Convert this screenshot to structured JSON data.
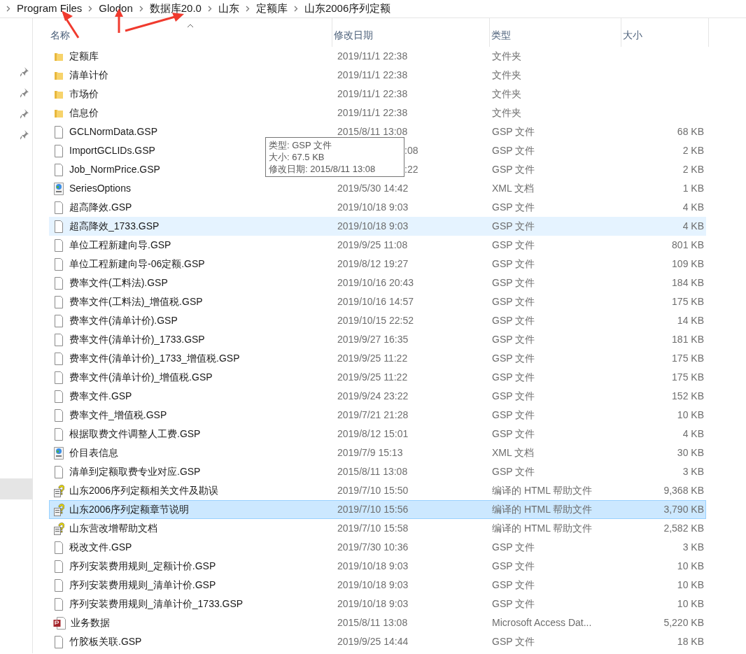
{
  "breadcrumb": [
    "Program Files",
    "Glodon",
    "数据库20.0",
    "山东",
    "定额库",
    "山东2006序列定额"
  ],
  "columns": [
    {
      "label": "名称",
      "sorted": true
    },
    {
      "label": "修改日期",
      "sorted": false
    },
    {
      "label": "类型",
      "sorted": false
    },
    {
      "label": "大小",
      "sorted": false
    }
  ],
  "rows": [
    {
      "kind": "folder",
      "name": "定额库",
      "date": "2019/11/1 22:38",
      "type": "文件夹",
      "size": "",
      "hovered": false,
      "selected": false,
      "date_covered": false
    },
    {
      "kind": "folder",
      "name": "清单计价",
      "date": "2019/11/1 22:38",
      "type": "文件夹",
      "size": "",
      "hovered": false,
      "selected": false,
      "date_covered": false
    },
    {
      "kind": "folder",
      "name": "市场价",
      "date": "2019/11/1 22:38",
      "type": "文件夹",
      "size": "",
      "hovered": false,
      "selected": false,
      "date_covered": false
    },
    {
      "kind": "folder",
      "name": "信息价",
      "date": "2019/11/1 22:38",
      "type": "文件夹",
      "size": "",
      "hovered": false,
      "selected": false,
      "date_covered": false
    },
    {
      "kind": "file",
      "name": "GCLNormData.GSP",
      "date": "2015/8/11 13:08",
      "type": "GSP 文件",
      "size": "68 KB",
      "hovered": false,
      "selected": false,
      "date_covered": false
    },
    {
      "kind": "file",
      "name": "ImportGCLIDs.GSP",
      "date": ":08",
      "type": "GSP 文件",
      "size": "2 KB",
      "hovered": false,
      "selected": false,
      "date_covered": true
    },
    {
      "kind": "file",
      "name": "Job_NormPrice.GSP",
      "date": ":22",
      "type": "GSP 文件",
      "size": "2 KB",
      "hovered": false,
      "selected": false,
      "date_covered": true
    },
    {
      "kind": "xml",
      "name": "SeriesOptions",
      "date": "2019/5/30 14:42",
      "type": "XML 文档",
      "size": "1 KB",
      "hovered": false,
      "selected": false,
      "date_covered": false
    },
    {
      "kind": "file",
      "name": "超高降效.GSP",
      "date": "2019/10/18 9:03",
      "type": "GSP 文件",
      "size": "4 KB",
      "hovered": false,
      "selected": false,
      "date_covered": false
    },
    {
      "kind": "file",
      "name": "超高降效_1733.GSP",
      "date": "2019/10/18 9:03",
      "type": "GSP 文件",
      "size": "4 KB",
      "hovered": true,
      "selected": false,
      "date_covered": false
    },
    {
      "kind": "file",
      "name": "单位工程新建向导.GSP",
      "date": "2019/9/25 11:08",
      "type": "GSP 文件",
      "size": "801 KB",
      "hovered": false,
      "selected": false,
      "date_covered": false
    },
    {
      "kind": "file",
      "name": "单位工程新建向导-06定额.GSP",
      "date": "2019/8/12 19:27",
      "type": "GSP 文件",
      "size": "109 KB",
      "hovered": false,
      "selected": false,
      "date_covered": false
    },
    {
      "kind": "file",
      "name": "费率文件(工料法).GSP",
      "date": "2019/10/16 20:43",
      "type": "GSP 文件",
      "size": "184 KB",
      "hovered": false,
      "selected": false,
      "date_covered": false
    },
    {
      "kind": "file",
      "name": "费率文件(工料法)_增值税.GSP",
      "date": "2019/10/16 14:57",
      "type": "GSP 文件",
      "size": "175 KB",
      "hovered": false,
      "selected": false,
      "date_covered": false
    },
    {
      "kind": "file",
      "name": "费率文件(清单计价).GSP",
      "date": "2019/10/15 22:52",
      "type": "GSP 文件",
      "size": "14 KB",
      "hovered": false,
      "selected": false,
      "date_covered": false
    },
    {
      "kind": "file",
      "name": "费率文件(清单计价)_1733.GSP",
      "date": "2019/9/27 16:35",
      "type": "GSP 文件",
      "size": "181 KB",
      "hovered": false,
      "selected": false,
      "date_covered": false
    },
    {
      "kind": "file",
      "name": "费率文件(清单计价)_1733_增值税.GSP",
      "date": "2019/9/25 11:22",
      "type": "GSP 文件",
      "size": "175 KB",
      "hovered": false,
      "selected": false,
      "date_covered": false
    },
    {
      "kind": "file",
      "name": "费率文件(清单计价)_增值税.GSP",
      "date": "2019/9/25 11:22",
      "type": "GSP 文件",
      "size": "175 KB",
      "hovered": false,
      "selected": false,
      "date_covered": false
    },
    {
      "kind": "file",
      "name": "费率文件.GSP",
      "date": "2019/9/24 23:22",
      "type": "GSP 文件",
      "size": "152 KB",
      "hovered": false,
      "selected": false,
      "date_covered": false
    },
    {
      "kind": "file",
      "name": "费率文件_增值税.GSP",
      "date": "2019/7/21 21:28",
      "type": "GSP 文件",
      "size": "10 KB",
      "hovered": false,
      "selected": false,
      "date_covered": false
    },
    {
      "kind": "file",
      "name": "根据取费文件调整人工费.GSP",
      "date": "2019/8/12 15:01",
      "type": "GSP 文件",
      "size": "4 KB",
      "hovered": false,
      "selected": false,
      "date_covered": false
    },
    {
      "kind": "xml",
      "name": "价目表信息",
      "date": "2019/7/9 15:13",
      "type": "XML 文档",
      "size": "30 KB",
      "hovered": false,
      "selected": false,
      "date_covered": false
    },
    {
      "kind": "file",
      "name": "清单到定额取费专业对应.GSP",
      "date": "2015/8/11 13:08",
      "type": "GSP 文件",
      "size": "3 KB",
      "hovered": false,
      "selected": false,
      "date_covered": false
    },
    {
      "kind": "help",
      "name": "山东2006序列定额相关文件及勘误",
      "date": "2019/7/10 15:50",
      "type": "编译的 HTML 帮助文件",
      "size": "9,368 KB",
      "hovered": false,
      "selected": false,
      "date_covered": false
    },
    {
      "kind": "help",
      "name": "山东2006序列定额章节说明",
      "date": "2019/7/10 15:56",
      "type": "编译的 HTML 帮助文件",
      "size": "3,790 KB",
      "hovered": false,
      "selected": true,
      "date_covered": false
    },
    {
      "kind": "help",
      "name": "山东营改增帮助文档",
      "date": "2019/7/10 15:58",
      "type": "编译的 HTML 帮助文件",
      "size": "2,582 KB",
      "hovered": false,
      "selected": false,
      "date_covered": false
    },
    {
      "kind": "file",
      "name": "税改文件.GSP",
      "date": "2019/7/30 10:36",
      "type": "GSP 文件",
      "size": "3 KB",
      "hovered": false,
      "selected": false,
      "date_covered": false
    },
    {
      "kind": "file",
      "name": "序列安装费用规则_定额计价.GSP",
      "date": "2019/10/18 9:03",
      "type": "GSP 文件",
      "size": "10 KB",
      "hovered": false,
      "selected": false,
      "date_covered": false
    },
    {
      "kind": "file",
      "name": "序列安装费用规则_清单计价.GSP",
      "date": "2019/10/18 9:03",
      "type": "GSP 文件",
      "size": "10 KB",
      "hovered": false,
      "selected": false,
      "date_covered": false
    },
    {
      "kind": "file",
      "name": "序列安装费用规则_清单计价_1733.GSP",
      "date": "2019/10/18 9:03",
      "type": "GSP 文件",
      "size": "10 KB",
      "hovered": false,
      "selected": false,
      "date_covered": false
    },
    {
      "kind": "access",
      "name": "业务数据",
      "date": "2015/8/11 13:08",
      "type": "Microsoft Access Dat...",
      "size": "5,220 KB",
      "hovered": false,
      "selected": false,
      "date_covered": false
    },
    {
      "kind": "file",
      "name": "竹胶板关联.GSP",
      "date": "2019/9/25 14:44",
      "type": "GSP 文件",
      "size": "18 KB",
      "hovered": false,
      "selected": false,
      "date_covered": false
    }
  ],
  "tooltip": [
    "类型: GSP 文件",
    "大小: 67.5 KB",
    "修改日期: 2015/8/11 13:08"
  ]
}
